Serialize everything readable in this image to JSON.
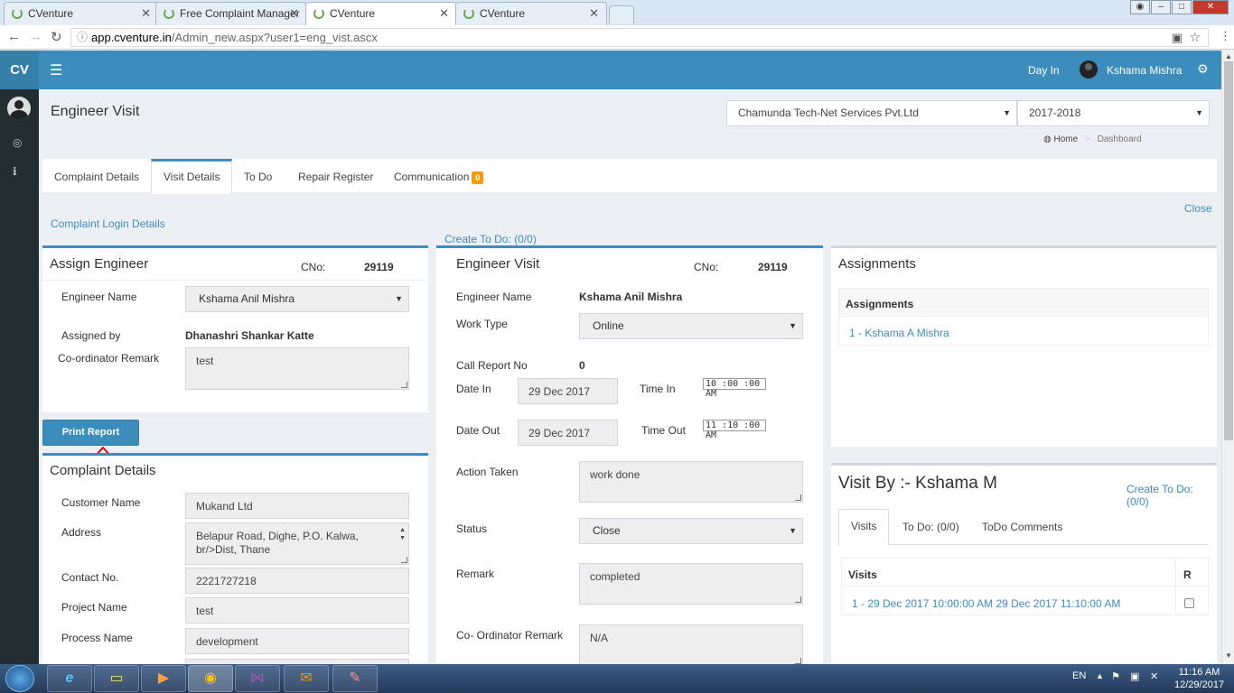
{
  "browser": {
    "tabs": [
      {
        "label": "CVenture"
      },
      {
        "label": "Free Complaint Manager"
      },
      {
        "label": "CVenture"
      },
      {
        "label": "CVenture"
      }
    ],
    "url_host": "app.cventure.in",
    "url_path": "/Admin_new.aspx?user1=eng_vist.ascx"
  },
  "topnav": {
    "logo": "CV",
    "day_in": "Day In",
    "username": "Kshama Mishra"
  },
  "page": {
    "title": "Engineer Visit",
    "company_select": "Chamunda Tech-Net Services Pvt.Ltd",
    "year_select": "2017-2018",
    "breadcrumb_home": "Home",
    "breadcrumb_current": "Dashboard"
  },
  "tabs": [
    {
      "label": "Complaint Details"
    },
    {
      "label": "Visit Details"
    },
    {
      "label": "To Do"
    },
    {
      "label": "Repair Register"
    },
    {
      "label": "Communication",
      "badge": "0"
    }
  ],
  "links": {
    "complaint_login": "Complaint Login Details",
    "create_todo": "Create To Do: (0/0)",
    "close": "Close"
  },
  "assign": {
    "title": "Assign Engineer",
    "cno_label": "CNo:",
    "cno_value": "29119",
    "engineer_label": "Engineer Name",
    "engineer_value": "Kshama Anil Mishra",
    "assigned_by_label": "Assigned by",
    "assigned_by_value": "Dhanashri Shankar Katte",
    "coord_label": "Co-ordinator Remark",
    "coord_value": "test",
    "print_button": "Print Report"
  },
  "complaint": {
    "title": "Complaint Details",
    "customer_label": "Customer Name",
    "customer_value": "Mukand Ltd",
    "address_label": "Address",
    "address_line1": "Belapur Road, Dighe, P.O. Kalwa,",
    "address_line2": "br/>Dist, Thane",
    "contact_label": "Contact No.",
    "contact_value": "2221727218",
    "project_label": "Project Name",
    "project_value": "test",
    "process_label": "Process Name",
    "process_value": "development"
  },
  "visit": {
    "title": "Engineer Visit",
    "cno_label": "CNo:",
    "cno_value": "29119",
    "engineer_label": "Engineer Name",
    "engineer_value": "Kshama Anil Mishra",
    "worktype_label": "Work Type",
    "worktype_value": "Online",
    "callreport_label": "Call Report No",
    "callreport_value": "0",
    "datein_label": "Date In",
    "datein_value": "29 Dec 2017",
    "timein_label": "Time In",
    "timein_value": "10 :00 :00 AM",
    "dateout_label": "Date Out",
    "dateout_value": "29 Dec 2017",
    "timeout_label": "Time Out",
    "timeout_value": "11 :10 :00 AM",
    "action_label": "Action Taken",
    "action_value": "work done",
    "status_label": "Status",
    "status_value": "Close",
    "remark_label": "Remark",
    "remark_value": "completed",
    "coord_label": "Co- Ordinator Remark",
    "coord_value": "N/A"
  },
  "assignments": {
    "title": "Assignments",
    "header": "Assignments",
    "item": "1 - Kshama A Mishra"
  },
  "visitby": {
    "title": "Visit By :- Kshama M",
    "create_todo": "Create To Do: (0/0)",
    "tabs": [
      {
        "label": "Visits"
      },
      {
        "label": "To Do: (0/0)"
      },
      {
        "label": "ToDo Comments"
      }
    ],
    "col_visits": "Visits",
    "col_r": "R",
    "row": "1 - 29 Dec 2017 10:00:00 AM 29 Dec 2017 11:10:00 AM"
  },
  "taskbar": {
    "lang": "EN",
    "time": "11:16 AM",
    "date": "12/29/2017"
  },
  "colors": {
    "primary": "#3c8dbc",
    "sidebar": "#222d32",
    "badge": "#f39c12",
    "arrow": "#e00000"
  }
}
